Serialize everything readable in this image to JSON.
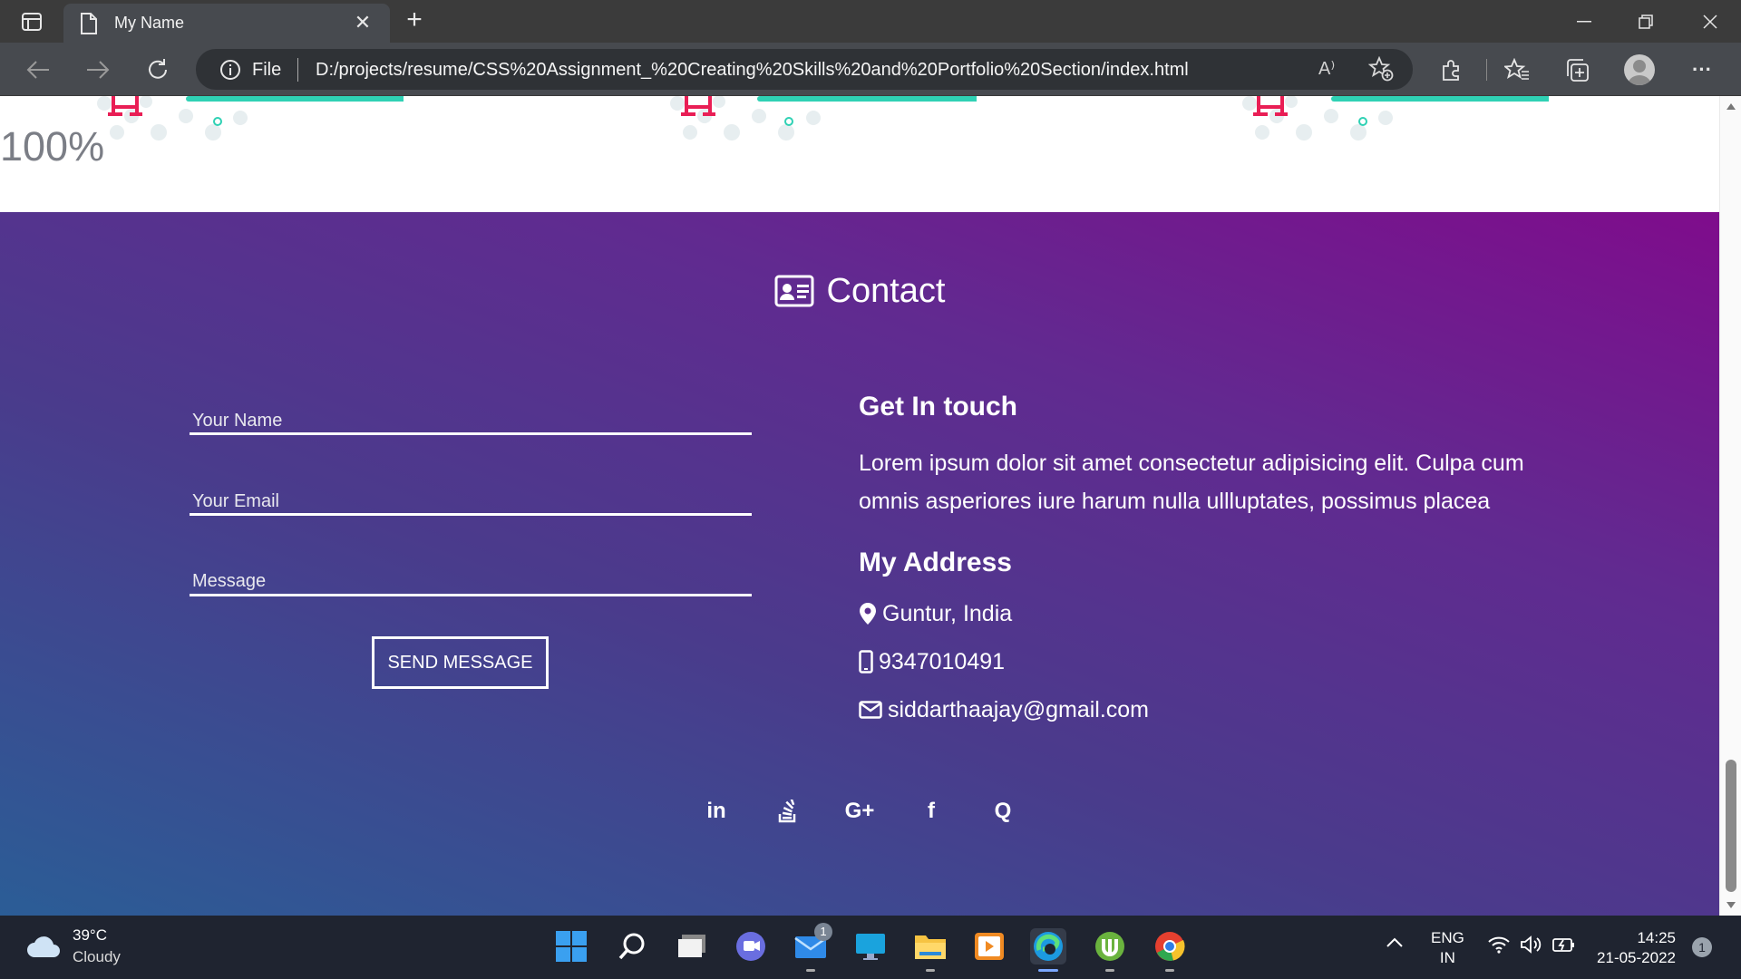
{
  "browser": {
    "tab_title": "My Name",
    "file_label": "File",
    "url": "D:/projects/resume/CSS%20Assignment_%20Creating%20Skills%20and%20Portfolio%20Section/index.html"
  },
  "portfolio": {
    "percent_label": "100%"
  },
  "contact": {
    "title": "Contact",
    "form": {
      "name_placeholder": "Your Name",
      "email_placeholder": "Your Email",
      "message_placeholder": "Message",
      "send_label": "SEND MESSAGE"
    },
    "get_in_touch_heading": "Get In touch",
    "description": "Lorem ipsum dolor sit amet consectetur adipisicing elit. Culpa cum omnis asperiores iure harum nulla ullluptates, possimus placea",
    "address_heading": "My Address",
    "location": "Guntur, India",
    "phone": "9347010491",
    "email": "siddarthaajay@gmail.com",
    "socials": [
      {
        "name": "linkedin-icon",
        "glyph": "in"
      },
      {
        "name": "stack-overflow-icon",
        "glyph": ""
      },
      {
        "name": "google-plus-icon",
        "glyph": "G+"
      },
      {
        "name": "facebook-icon",
        "glyph": "f"
      },
      {
        "name": "quora-icon",
        "glyph": "Q"
      }
    ],
    "gradient_colors": [
      "#2b5d96",
      "#4a3b8c",
      "#612a90",
      "#7f0c8c"
    ]
  },
  "taskbar": {
    "weather_temp": "39°C",
    "weather_condition": "Cloudy",
    "mail_badge": "1",
    "language_top": "ENG",
    "language_bottom": "IN",
    "time": "14:25",
    "date": "21-05-2022",
    "notification_count": "1"
  }
}
